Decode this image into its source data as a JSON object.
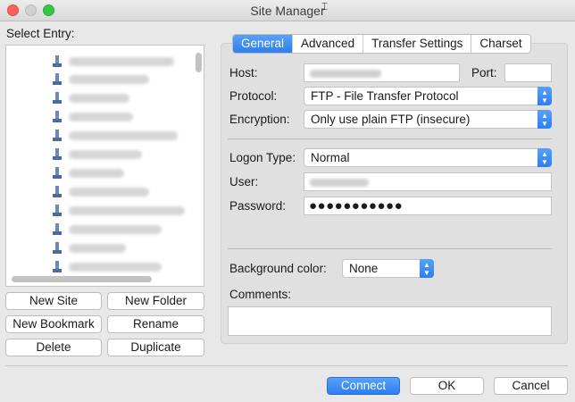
{
  "window": {
    "title": "Site Manager"
  },
  "tree": {
    "label": "Select Entry:",
    "item_count": 12
  },
  "buttons": {
    "new_site": "New Site",
    "new_folder": "New Folder",
    "new_bookmark": "New Bookmark",
    "rename": "Rename",
    "delete": "Delete",
    "duplicate": "Duplicate"
  },
  "tabs": [
    {
      "label": "General",
      "active": true
    },
    {
      "label": "Advanced",
      "active": false
    },
    {
      "label": "Transfer Settings",
      "active": false
    },
    {
      "label": "Charset",
      "active": false
    }
  ],
  "general": {
    "host_label": "Host:",
    "port_label": "Port:",
    "port_value": "",
    "protocol_label": "Protocol:",
    "protocol_value": "FTP - File Transfer Protocol",
    "encryption_label": "Encryption:",
    "encryption_value": "Only use plain FTP (insecure)",
    "logon_type_label": "Logon Type:",
    "logon_type_value": "Normal",
    "user_label": "User:",
    "password_label": "Password:",
    "password_value": "●●●●●●●●●●●",
    "background_color_label": "Background color:",
    "background_color_value": "None",
    "comments_label": "Comments:",
    "comments_value": ""
  },
  "footer": {
    "connect": "Connect",
    "ok": "OK",
    "cancel": "Cancel"
  },
  "colors": {
    "accent": "#2c7ff0",
    "close": "#fc605c",
    "maximize": "#34c84a"
  },
  "icons": {
    "stepper": "up-down-chevron-icon",
    "site": "site-server-icon"
  }
}
